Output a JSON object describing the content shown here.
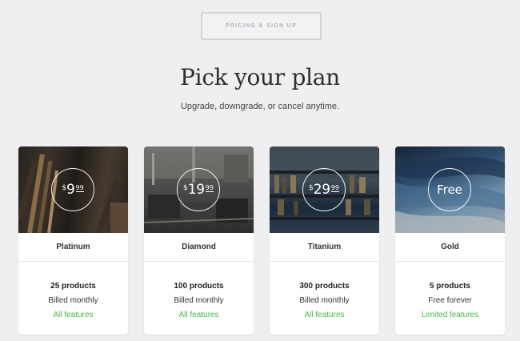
{
  "header": {
    "button_label": "PRICING & SIGN UP"
  },
  "hero": {
    "title": "Pick your plan",
    "subtitle": "Upgrade, downgrade, or cancel anytime."
  },
  "colors": {
    "accent_green": "#4ab548",
    "background": "#efeff1"
  },
  "plans": [
    {
      "currency": "$",
      "amount": "9",
      "cents": "99",
      "name": "Platinum",
      "products": "25 products",
      "billing": "Billed monthly",
      "features": "All features"
    },
    {
      "currency": "$",
      "amount": "19",
      "cents": "99",
      "name": "Diamond",
      "products": "100 products",
      "billing": "Billed monthly",
      "features": "All features"
    },
    {
      "currency": "$",
      "amount": "29",
      "cents": "99",
      "name": "Titanium",
      "products": "300 products",
      "billing": "Billed monthly",
      "features": "All features"
    },
    {
      "free_label": "Free",
      "name": "Gold",
      "products": "5 products",
      "billing": "Free forever",
      "features": "Limited features"
    }
  ]
}
